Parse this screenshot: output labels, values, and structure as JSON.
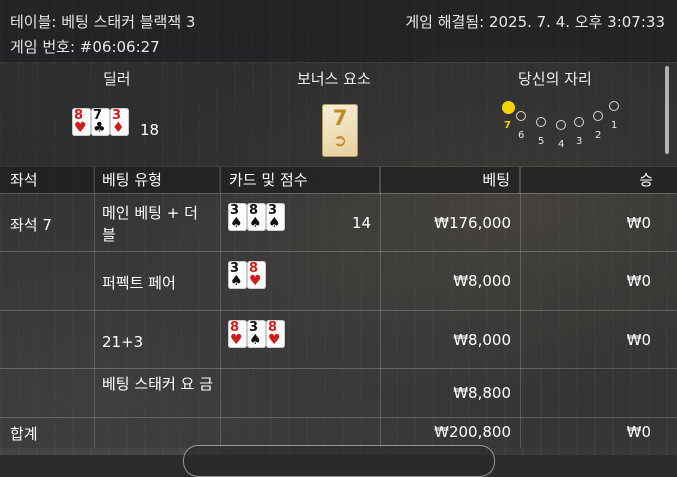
{
  "header": {
    "table_title": "테이블: 베팅 스태커 블랙잭 3",
    "game_number": "게임 번호: #06:06:27",
    "resolved": "게임 해결됨: 2025. 7. 4. 오후 3:07:33"
  },
  "summary": {
    "dealer_label": "딜러",
    "bonus_label": "보너스 요소",
    "your_seat_label": "당신의 자리",
    "dealer_cards": [
      {
        "rank": "8",
        "suit": "♥",
        "color": "red"
      },
      {
        "rank": "7",
        "suit": "♣",
        "color": "black"
      },
      {
        "rank": "3",
        "suit": "♦",
        "color": "red"
      }
    ],
    "dealer_score": "18",
    "bonus_card": {
      "rank": "7",
      "symbol": "➲"
    },
    "seats": [
      "7",
      "6",
      "5",
      "4",
      "3",
      "2",
      "1"
    ],
    "active_seat": "7"
  },
  "table": {
    "headers": {
      "seat": "좌석",
      "bet_type": "베팅 유형",
      "cards": "카드 및 점수",
      "bet": "베팅",
      "win": "승"
    },
    "rows": [
      {
        "seat": "좌석 7",
        "bet_type": "메인 베팅 + 더 블",
        "cards": [
          {
            "rank": "3",
            "suit": "♠",
            "color": "black"
          },
          {
            "rank": "8",
            "suit": "♠",
            "color": "black"
          },
          {
            "rank": "3",
            "suit": "♠",
            "color": "black"
          }
        ],
        "score": "14",
        "bet": "₩176,000",
        "win": "₩0"
      },
      {
        "seat": "",
        "bet_type": "퍼펙트 페어",
        "cards": [
          {
            "rank": "3",
            "suit": "♠",
            "color": "black"
          },
          {
            "rank": "8",
            "suit": "♥",
            "color": "red"
          }
        ],
        "score": "",
        "bet": "₩8,000",
        "win": "₩0"
      },
      {
        "seat": "",
        "bet_type": "21+3",
        "cards": [
          {
            "rank": "8",
            "suit": "♥",
            "color": "red"
          },
          {
            "rank": "3",
            "suit": "♠",
            "color": "black"
          },
          {
            "rank": "8",
            "suit": "♥",
            "color": "red"
          }
        ],
        "score": "",
        "bet": "₩8,000",
        "win": "₩0"
      },
      {
        "seat": "",
        "bet_type": "베팅 스태커 요 금",
        "cards": [],
        "score": "",
        "bet": "₩8,800",
        "win": ""
      }
    ],
    "total": {
      "label": "합계",
      "bet": "₩200,800",
      "win": "₩0"
    }
  }
}
